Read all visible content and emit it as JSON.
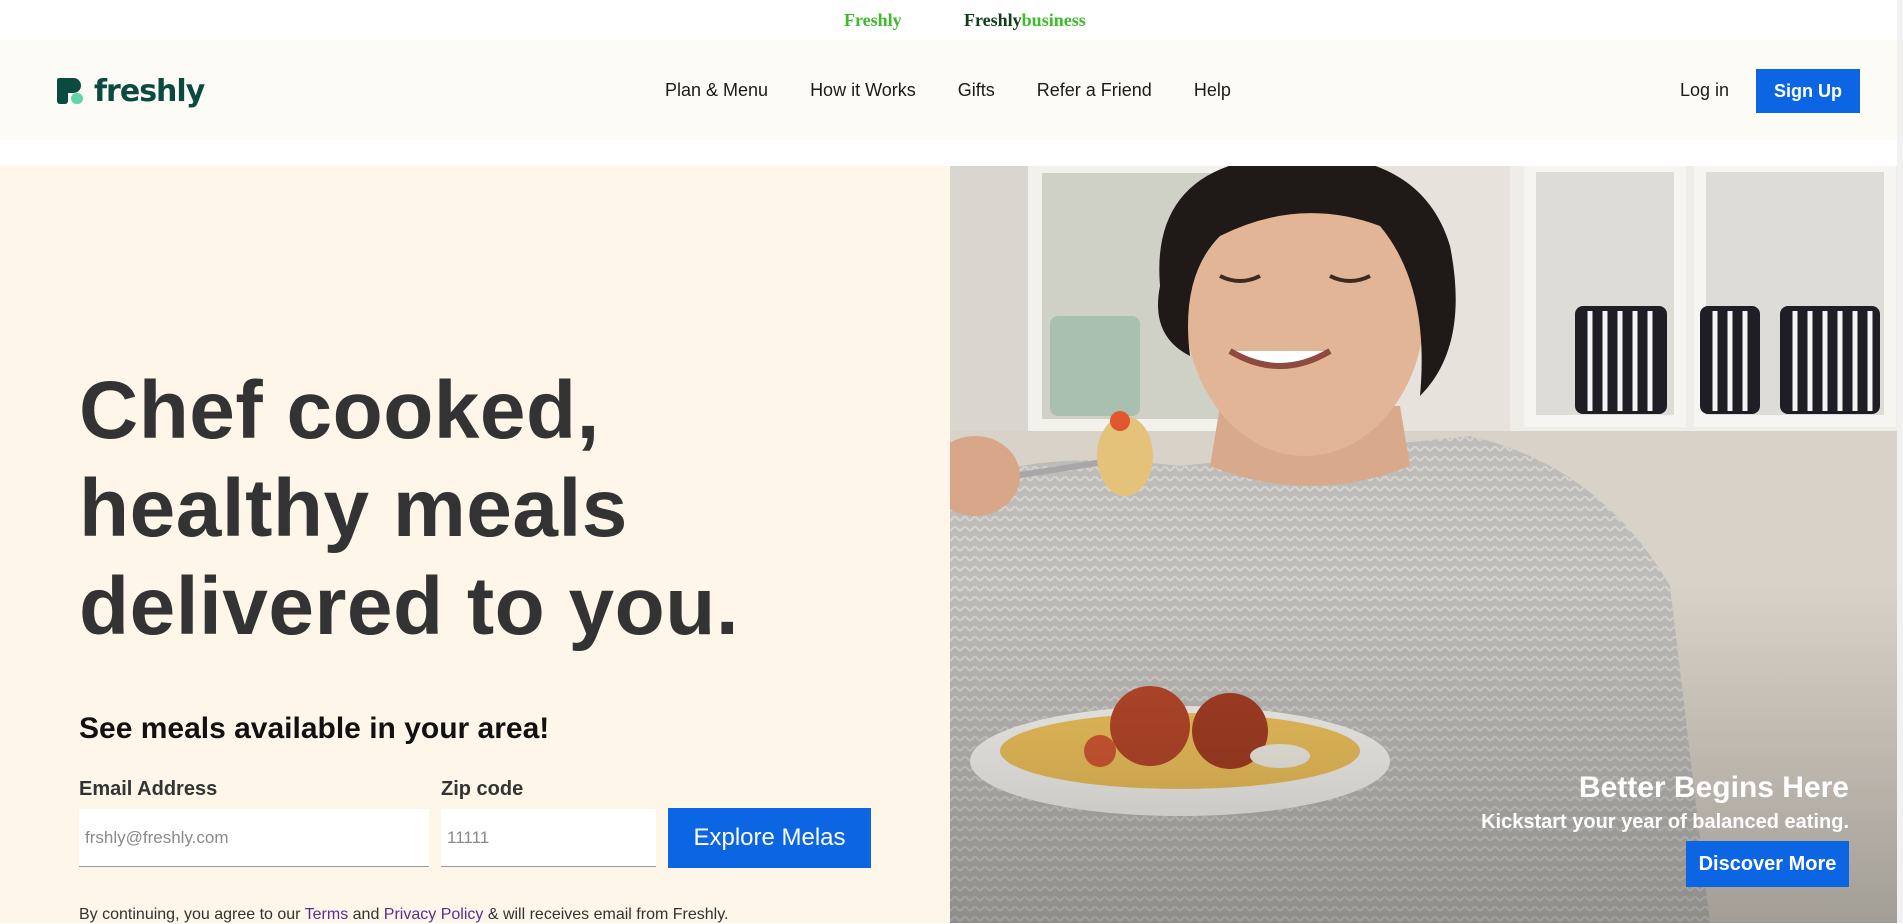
{
  "brand_switcher": {
    "freshly_label": "Freshly",
    "business_prefix": "Freshly",
    "business_suffix": "business"
  },
  "header": {
    "logo_text": "freshly",
    "nav": [
      {
        "label": "Plan & Menu"
      },
      {
        "label": "How it Works"
      },
      {
        "label": "Gifts"
      },
      {
        "label": "Refer a Friend"
      },
      {
        "label": "Help"
      }
    ],
    "login_label": "Log in",
    "signup_label": "Sign Up"
  },
  "hero": {
    "headline": "Chef cooked, healthy meals delivered to you.",
    "subhead": "See meals available in your area!",
    "form": {
      "email_label": "Email Address",
      "email_placeholder": "frshly@freshly.com",
      "zip_label": "Zip code",
      "zip_placeholder": "11111",
      "submit_label": "Explore Melas"
    },
    "disclaimer": {
      "before_terms": "By continuing, you agree to our ",
      "terms": "Terms",
      "and": " and ",
      "privacy": "Privacy Policy",
      "after": " & will receives email from Freshly."
    }
  },
  "promo": {
    "title": "Better Begins Here",
    "subtitle": "Kickstart your year of balanced eating.",
    "cta_label": "Discover More"
  },
  "colors": {
    "accent": "#0c66e4",
    "brand_green": "#3dbb2a",
    "logo_dark": "#0b4a3f",
    "logo_mint": "#62d5a8",
    "hero_bg": "#fdf6e9",
    "nav_bg": "#fdfbf6"
  }
}
